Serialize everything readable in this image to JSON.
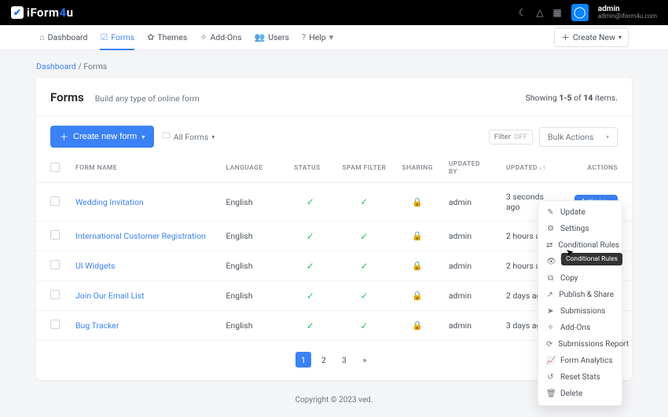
{
  "brand": {
    "prefix": "iForm",
    "suffix": "u",
    "four": "4"
  },
  "user": {
    "name": "admin",
    "email": "admin@iform4u.com"
  },
  "nav": {
    "dashboard": "Dashboard",
    "forms": "Forms",
    "themes": "Themes",
    "addons": "Add-Ons",
    "users": "Users",
    "help": "Help",
    "create_new": "Create New"
  },
  "breadcrumb": {
    "dashboard": "Dashboard",
    "current": "Forms"
  },
  "card": {
    "title": "Forms",
    "subtitle": "Build any type of online form",
    "summary_prefix": "Showing ",
    "summary_range": "1-5",
    "summary_mid": " of ",
    "summary_total": "14",
    "summary_suffix": " items."
  },
  "toolbar": {
    "create_form": "Create new form",
    "all_forms": "All Forms",
    "filter": "Filter",
    "filter_state": "OFF",
    "bulk": "Bulk Actions"
  },
  "columns": {
    "form_name": "FORM NAME",
    "language": "LANGUAGE",
    "status": "STATUS",
    "spam": "SPAM FILTER",
    "sharing": "SHARING",
    "updated_by": "UPDATED BY",
    "updated": "UPDATED",
    "actions": "ACTIONS"
  },
  "rows": [
    {
      "name": "Wedding Invitation",
      "lang": "English",
      "by": "admin",
      "updated": "3 seconds ago",
      "show_btn": true
    },
    {
      "name": "International Customer Registration",
      "lang": "English",
      "by": "admin",
      "updated": "2 hours ago",
      "show_btn": false
    },
    {
      "name": "UI Widgets",
      "lang": "English",
      "by": "admin",
      "updated": "2 hours ago",
      "show_btn": false
    },
    {
      "name": "Join Our Email List",
      "lang": "English",
      "by": "admin",
      "updated": "2 days ago",
      "show_btn": false
    },
    {
      "name": "Bug Tracker",
      "lang": "English",
      "by": "admin",
      "updated": "3 days ago",
      "show_btn": false
    }
  ],
  "actions_btn": "Actions",
  "pagination": {
    "p1": "1",
    "p2": "2",
    "p3": "3",
    "next": "»"
  },
  "footer": "Copyright © 2023                                             ved.",
  "dropdown": {
    "update": "Update",
    "settings": "Settings",
    "conditional": "Conditional Rules",
    "vie": "Vie",
    "copy": "Copy",
    "publish": "Publish & Share",
    "submissions": "Submissions",
    "addons": "Add-Ons",
    "sub_report": "Submissions Report",
    "analytics": "Form Analytics",
    "reset": "Reset Stats",
    "delete": "Delete"
  },
  "tooltip": "Conditional Rules"
}
